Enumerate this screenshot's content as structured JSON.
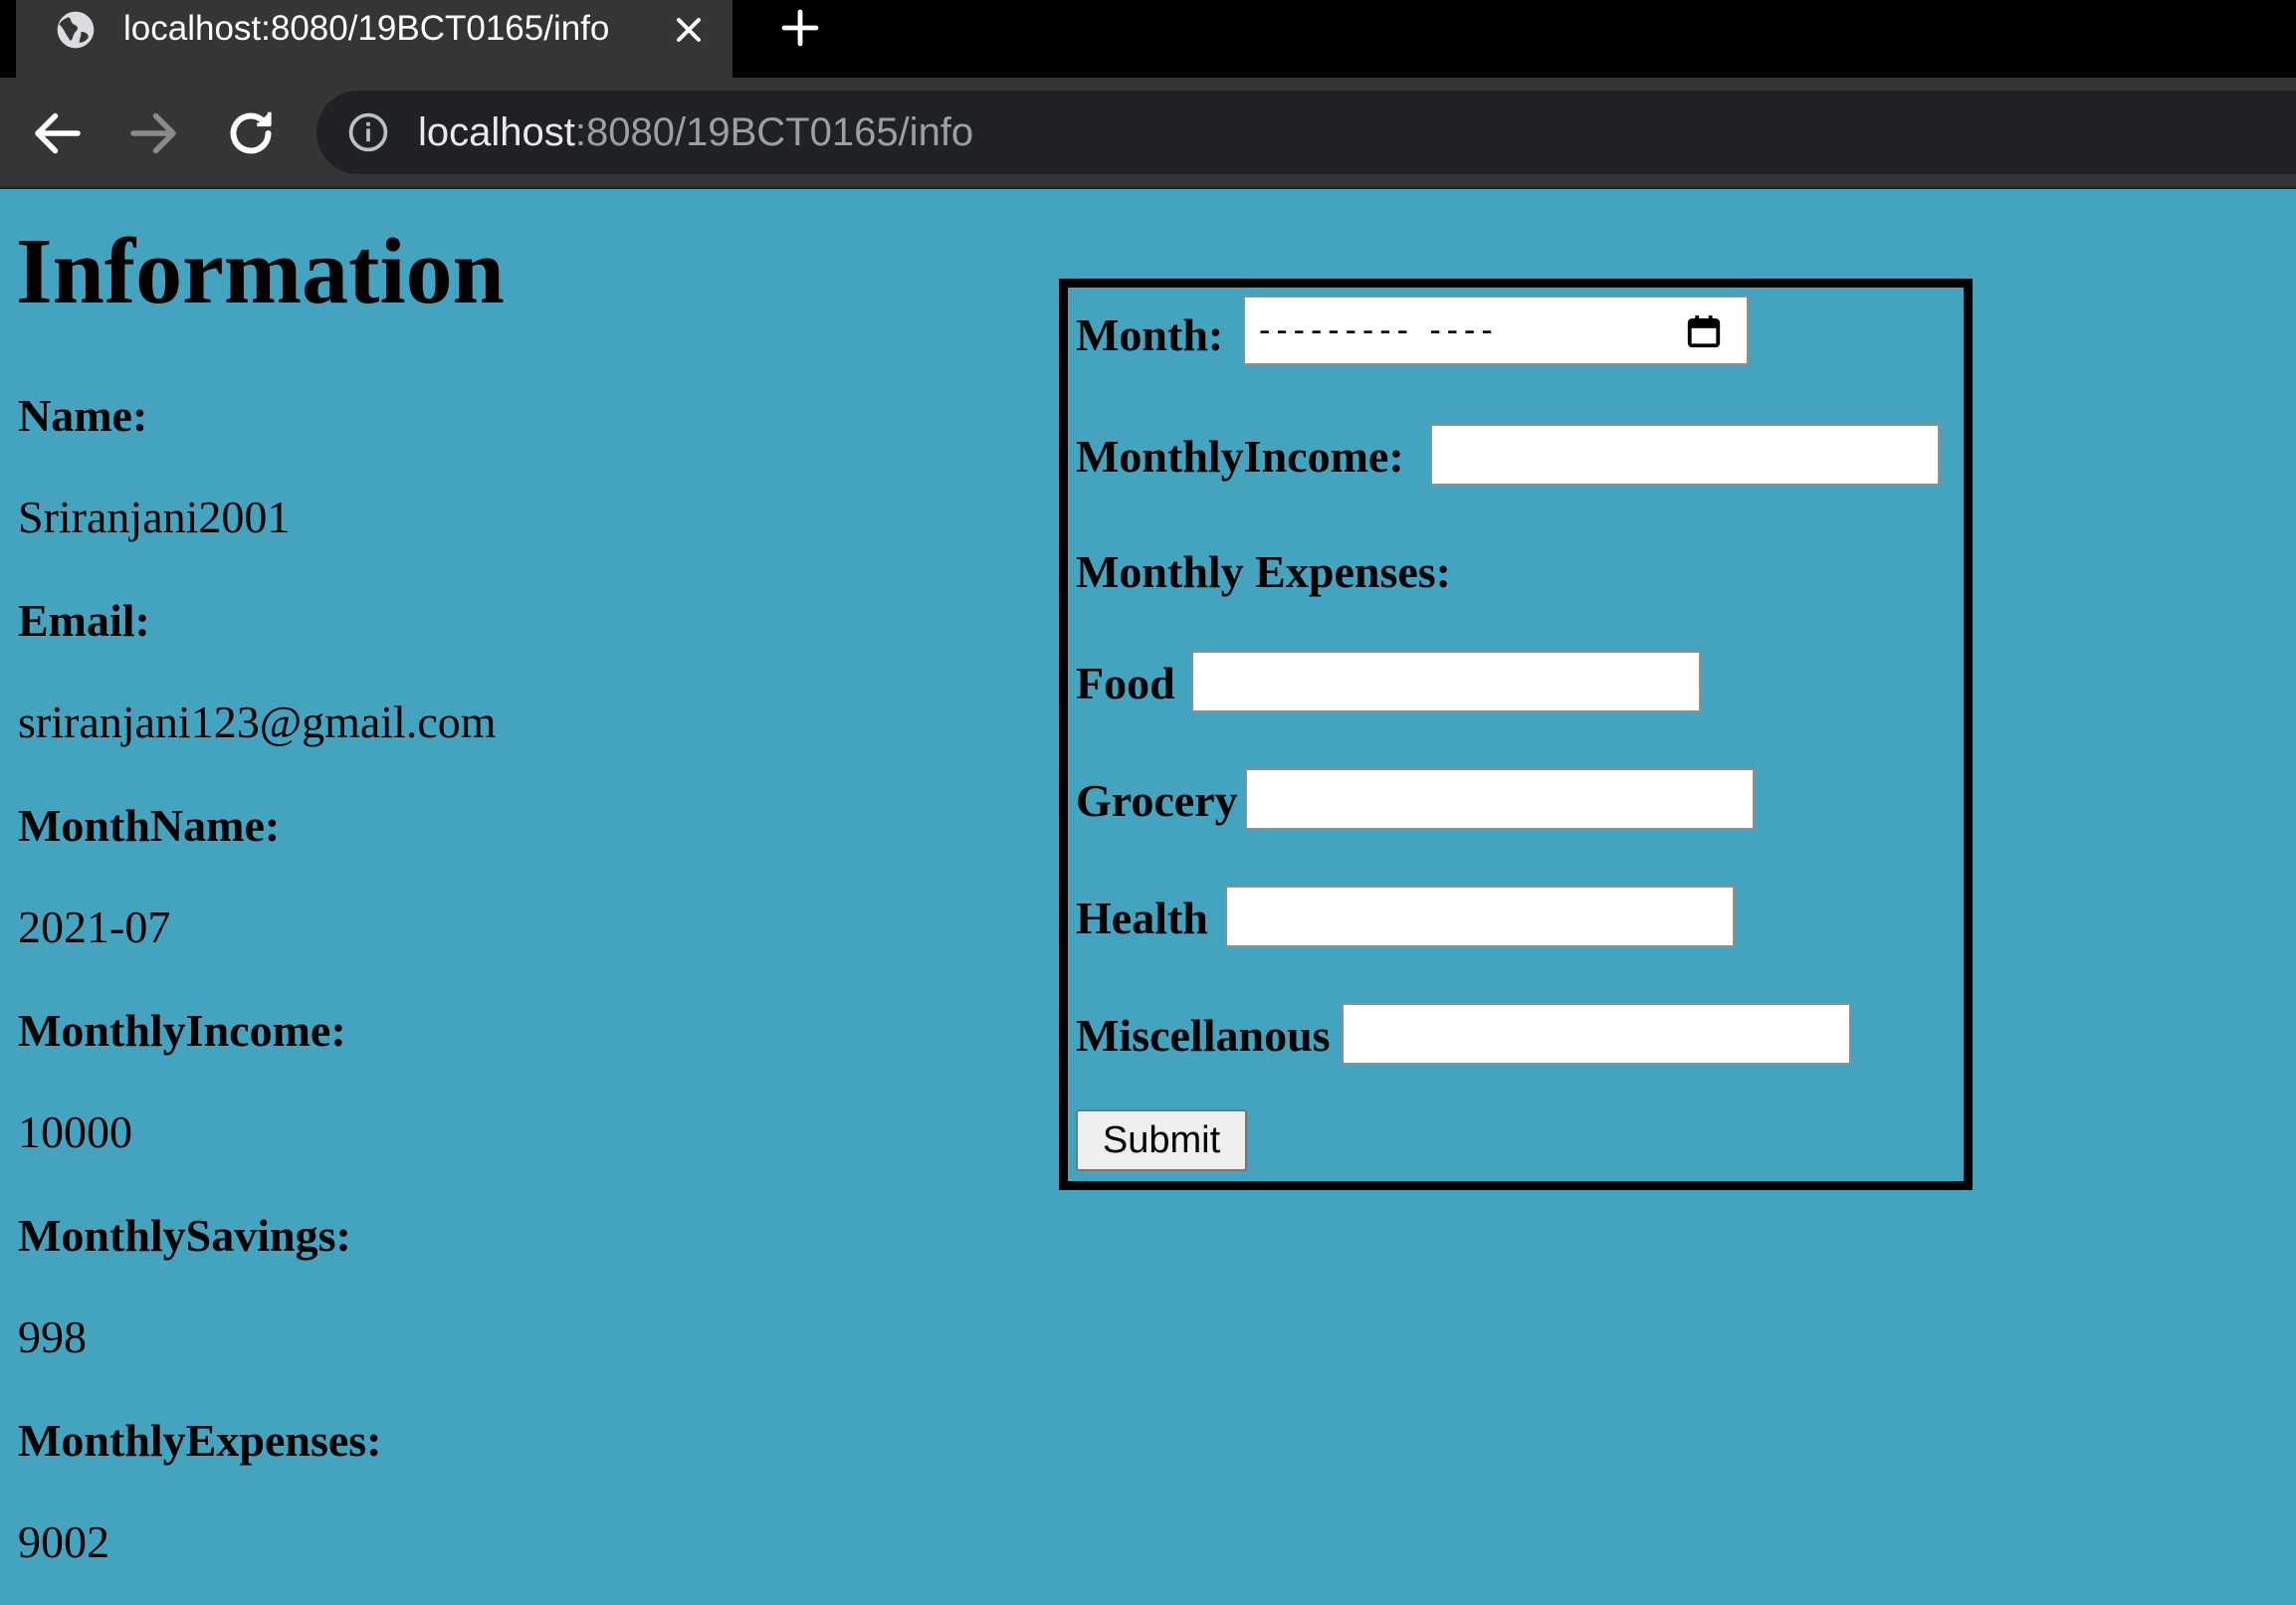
{
  "browser": {
    "tab_title": "localhost:8080/19BCT0165/info",
    "url_host": "localhost",
    "url_path": ":8080/19BCT0165/info",
    "icons": [
      "globe-icon",
      "close-icon",
      "plus-icon",
      "back-arrow-icon",
      "forward-arrow-icon",
      "reload-icon",
      "info-icon"
    ]
  },
  "page": {
    "heading": "Information",
    "info": [
      {
        "label": "Name:",
        "value": "Sriranjani2001"
      },
      {
        "label": "Email:",
        "value": "sriranjani123@gmail.com"
      },
      {
        "label": "MonthName:",
        "value": "2021-07"
      },
      {
        "label": "MonthlyIncome:",
        "value": "10000"
      },
      {
        "label": "MonthlySavings:",
        "value": "998"
      },
      {
        "label": "MonthlyExpenses:",
        "value": "9002"
      }
    ]
  },
  "form": {
    "month_label": "Month:",
    "month_placeholder": "--------- ----",
    "income_label": "MonthlyIncome:",
    "expenses_section": "Monthly Expenses:",
    "food_label": "Food",
    "grocery_label": "Grocery",
    "health_label": "Health",
    "misc_label": "Miscellanous",
    "submit_label": "Submit",
    "income_value": "",
    "food_value": "",
    "grocery_value": "",
    "health_value": "",
    "misc_value": ""
  },
  "colors": {
    "page_background": "#44a3bf",
    "chrome_dark": "#000000",
    "toolbar": "#353535",
    "omnibox": "#202124"
  }
}
